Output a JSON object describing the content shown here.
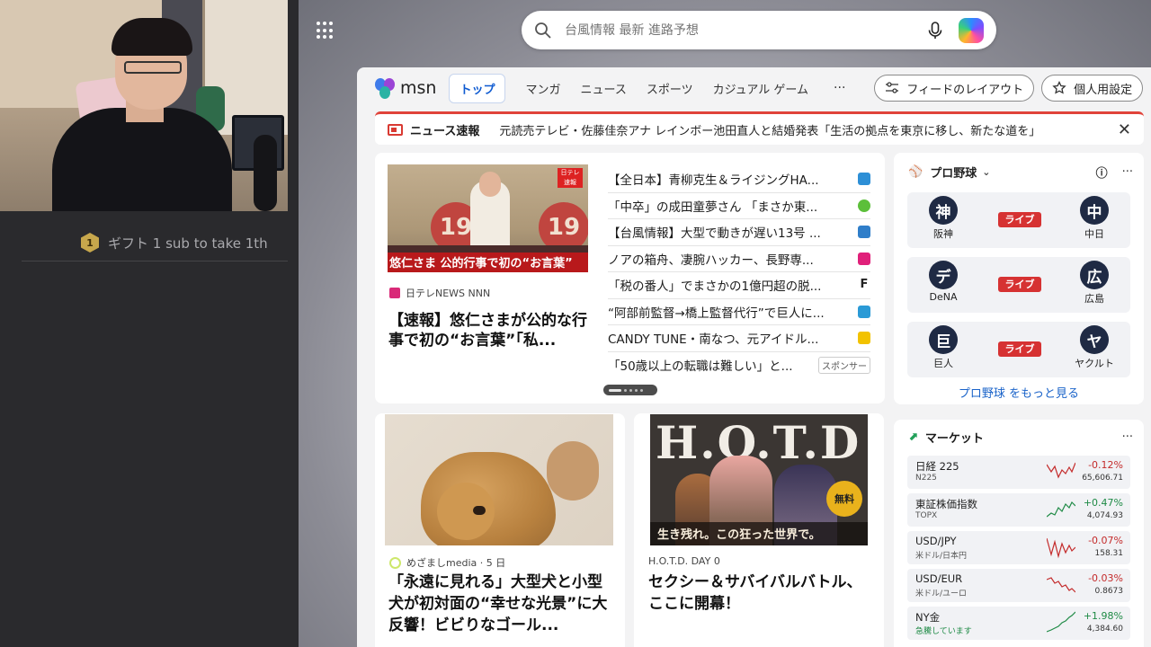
{
  "stream": {
    "gift_badge": "1",
    "gift_text": "ギフト 1 sub to take 1th"
  },
  "search": {
    "placeholder": "台風情報 最新 進路予想"
  },
  "msn": {
    "logo_text": "msn",
    "tabs": [
      {
        "label": "トップ",
        "active": true
      },
      {
        "label": "マンガ"
      },
      {
        "label": "ニュース"
      },
      {
        "label": "スポーツ"
      },
      {
        "label": "カジュアル ゲーム"
      }
    ],
    "more": "···",
    "feed_layout_label": "フィードのレイアウト",
    "personalize_label": "個人用設定"
  },
  "breaking": {
    "label": "ニュース速報",
    "text": "元読売テレビ・佐藤佳奈アナ レインボー池田直人と結婚発表「生活の拠点を東京に移し、新たな道を」",
    "close": "✕"
  },
  "top_story": {
    "image_caption": "悠仁さま 公的行事で初の“お言葉”",
    "source": "日テレNEWS NNN",
    "title": "【速報】悠仁さまが公的な行事で初の“お言葉”「私..."
  },
  "headlines": [
    {
      "text": "【全日本】青柳克生＆ライジングHA...",
      "logo_color": "#2d8fd6"
    },
    {
      "text": "「中卒」の成田童夢さん 「まさか東...",
      "logo_color": "#5cbf3a"
    },
    {
      "text": "【台風情報】大型で動きが遅い13号 ...",
      "logo_color": "#2f7ec9"
    },
    {
      "text": "ノアの箱舟、凄腕ハッカー、長野専...",
      "logo_color": "#e0207a"
    },
    {
      "text": "「税の番人」でまさかの1億円超の脱...",
      "logo_color": "#222222"
    },
    {
      "text": "“阿部前監督→橋上監督代行”で巨人に...",
      "logo_color": "#2a9ad6"
    },
    {
      "text": "CANDY TUNE・南なつ、元アイドル...",
      "logo_color": "#f2c200"
    },
    {
      "text": "「50歳以上の転職は難しい」と...",
      "logo_color": "",
      "sponsor": "スポンサー"
    }
  ],
  "baseball": {
    "title": "プロ野球",
    "chevron": "⌄",
    "info": "ⓘ",
    "dots": "···",
    "games": [
      {
        "home_initial": "神",
        "home_name": "阪神",
        "status": "ライブ",
        "away_initial": "中",
        "away_name": "中日"
      },
      {
        "home_initial": "デ",
        "home_name": "DeNA",
        "status": "ライブ",
        "away_initial": "広",
        "away_name": "広島"
      },
      {
        "home_initial": "巨",
        "home_name": "巨人",
        "status": "ライブ",
        "away_initial": "ヤ",
        "away_name": "ヤクルト"
      }
    ],
    "more_link": "プロ野球 をもっと見る"
  },
  "dog_article": {
    "source": "めざましmedia · 5 日",
    "title": "「永遠に見れる」大型犬と小型犬が初対面の“幸せな光景”に大反響！ビビりなゴール..."
  },
  "hotd_article": {
    "badge": "無料",
    "tagline": "生き残れ。この狂った世界で。",
    "source": "H.O.T.D. DAY 0",
    "title": "セクシー＆サバイバルバトル、ここに開幕！"
  },
  "market": {
    "title": "マーケット",
    "dots": "···",
    "stocks": [
      {
        "name": "日経 225",
        "code": "N225",
        "change": "-0.12%",
        "value": "65,606.71",
        "trend": "down"
      },
      {
        "name": "東証株価指数",
        "code": "TOPX",
        "change": "+0.47%",
        "value": "4,074.93",
        "trend": "up"
      },
      {
        "name": "USD/JPY",
        "code": "米ドル/日本円",
        "change": "-0.07%",
        "value": "158.31",
        "trend": "down"
      },
      {
        "name": "USD/EUR",
        "code": "米ドル/ユーロ",
        "change": "-0.03%",
        "value": "0.8673",
        "trend": "down"
      },
      {
        "name": "NY金",
        "code": "急騰しています",
        "change": "+1.98%",
        "value": "4,384.60",
        "trend": "up"
      }
    ]
  },
  "colors": {
    "accent": "#0f5bd1",
    "breaking_red": "#e0433a",
    "up": "#1e8a45",
    "down": "#c42b2b",
    "live": "#d63232"
  }
}
